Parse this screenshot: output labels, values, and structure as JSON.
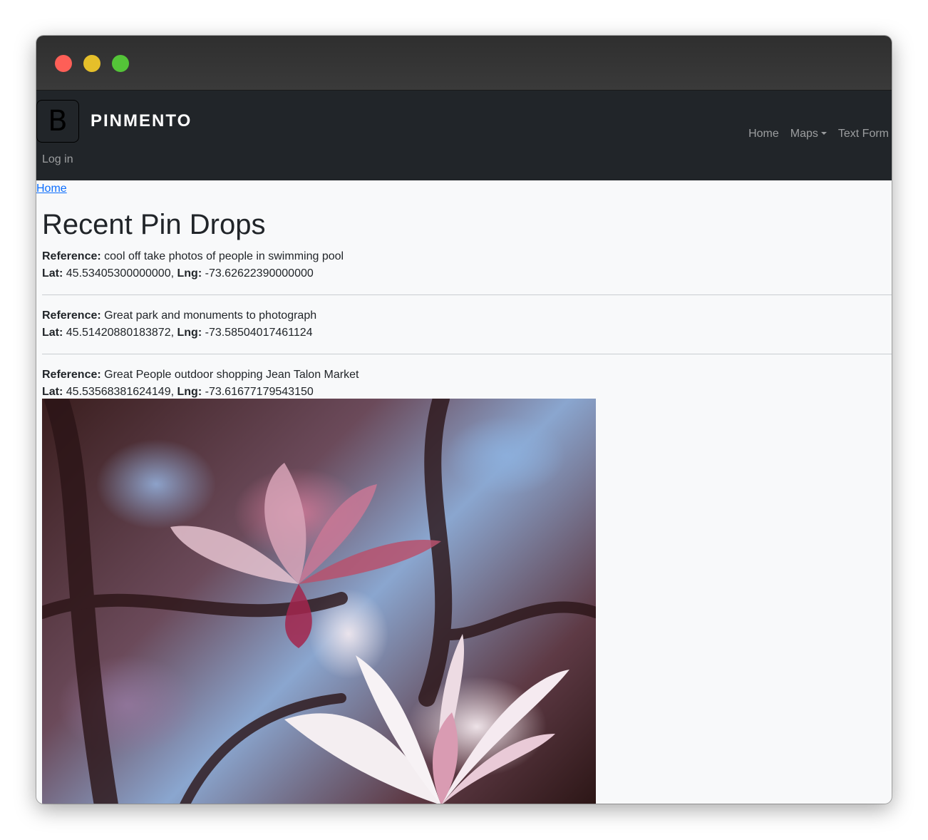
{
  "navbar": {
    "brand_letter": "B",
    "brand_name": "PINMENTO",
    "links": [
      "Home",
      "Maps",
      "Text Form"
    ],
    "login_label": "Log in"
  },
  "breadcrumb": {
    "home_label": "Home"
  },
  "page": {
    "title": "Recent Pin Drops"
  },
  "labels": {
    "reference": "Reference:",
    "lat": "Lat:",
    "lng": "Lng:"
  },
  "pins": [
    {
      "reference": "cool off take photos of people in swimming pool",
      "lat": "45.53405300000000",
      "lng": "-73.62622390000000"
    },
    {
      "reference": "Great park and monuments to photograph",
      "lat": "45.51420880183872",
      "lng": "-73.58504017461124"
    },
    {
      "reference": "Great People outdoor shopping Jean Talon Market",
      "lat": "45.53568381624149",
      "lng": "-73.61677179543150"
    }
  ],
  "colors": {
    "navbar_bg": "#212529",
    "link": "#0d6efd",
    "page_bg": "#f8f9fa"
  },
  "photo_icon": "magnolia-photo"
}
